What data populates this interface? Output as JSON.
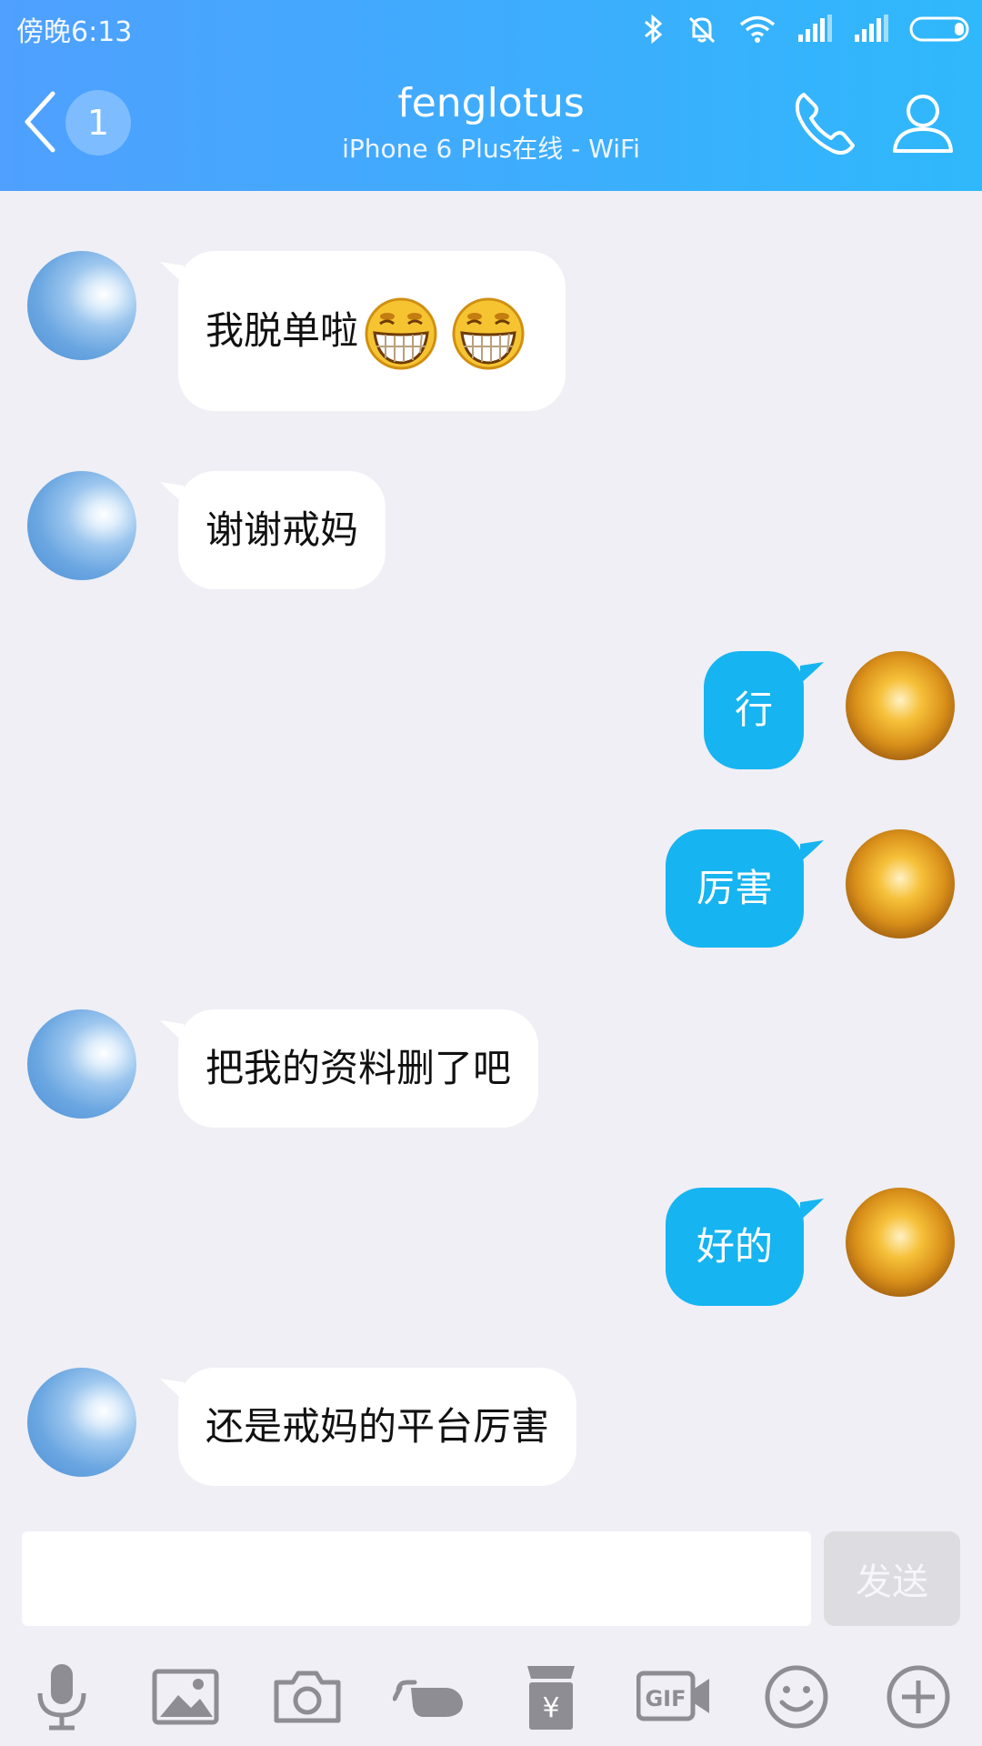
{
  "status": {
    "time": "傍晚6:13"
  },
  "header": {
    "unread_count": "1",
    "title": "fenglotus",
    "subtitle": "iPhone 6 Plus在线 - WiFi"
  },
  "messages": [
    {
      "side": "in",
      "text": "我脱单啦"
    },
    {
      "side": "in",
      "text": "谢谢戒妈"
    },
    {
      "side": "out",
      "text": "行"
    },
    {
      "side": "out",
      "text": "厉害"
    },
    {
      "side": "in",
      "text": "把我的资料删了吧"
    },
    {
      "side": "out",
      "text": "好的"
    },
    {
      "side": "in",
      "text": "还是戒妈的平台厉害"
    }
  ],
  "input": {
    "value": "",
    "placeholder": ""
  },
  "send_label": "发送",
  "toolbar_icons": [
    "microphone-icon",
    "image-icon",
    "camera-icon",
    "poke-hand-icon",
    "red-packet-icon",
    "gif-icon",
    "smiley-icon",
    "plus-icon"
  ],
  "colors": {
    "header_start": "#4fa0ff",
    "header_end": "#2fb8fb",
    "bubble_out": "#16b4f1",
    "background": "#efeff5"
  }
}
